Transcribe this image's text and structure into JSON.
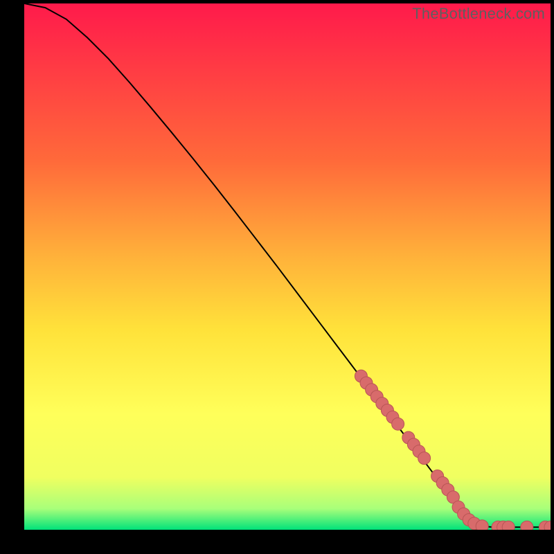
{
  "citation": "TheBottleneck.com",
  "colors": {
    "grad_top": "#ff1a4b",
    "grad_mid1": "#ff6a3a",
    "grad_mid2": "#ffb13a",
    "grad_mid3": "#ffe23a",
    "grad_mid4": "#ffff5a",
    "grad_mid5": "#f0ff60",
    "grad_mid6": "#a8ff7a",
    "grad_bottom": "#00e27a",
    "curve": "#000000",
    "marker_fill": "#d86b6b",
    "marker_stroke": "#b85555"
  },
  "chart_data": {
    "type": "line",
    "title": "",
    "xlabel": "",
    "ylabel": "",
    "xlim": [
      0,
      100
    ],
    "ylim": [
      0,
      100
    ],
    "curve": {
      "x": [
        0,
        4,
        8,
        12,
        16,
        20,
        24,
        28,
        32,
        36,
        40,
        44,
        48,
        52,
        56,
        60,
        64,
        68,
        72,
        76,
        80,
        82.5,
        85,
        87,
        89,
        91,
        94,
        97,
        100
      ],
      "y": [
        100,
        99.2,
        97,
        93.5,
        89.5,
        85,
        80.3,
        75.5,
        70.6,
        65.6,
        60.5,
        55.3,
        50.1,
        44.8,
        39.5,
        34.2,
        28.9,
        23.6,
        18.3,
        13.0,
        7.7,
        4.3,
        1.4,
        0.7,
        0.5,
        0.5,
        0.5,
        0.5,
        0.5
      ]
    },
    "markers": {
      "x": [
        64,
        65,
        66,
        67,
        68,
        69,
        70,
        71,
        73,
        74,
        75,
        76,
        78.5,
        79.5,
        80.5,
        81.5,
        82.5,
        83.5,
        84.5,
        85.5,
        87,
        90,
        91,
        92,
        95.5,
        99,
        100
      ],
      "y": [
        29.2,
        27.9,
        26.6,
        25.3,
        24.0,
        22.7,
        21.4,
        20.1,
        17.5,
        16.2,
        14.9,
        13.6,
        10.2,
        8.9,
        7.6,
        6.2,
        4.3,
        3.0,
        1.9,
        1.2,
        0.7,
        0.5,
        0.5,
        0.5,
        0.5,
        0.5,
        0.5
      ]
    }
  }
}
